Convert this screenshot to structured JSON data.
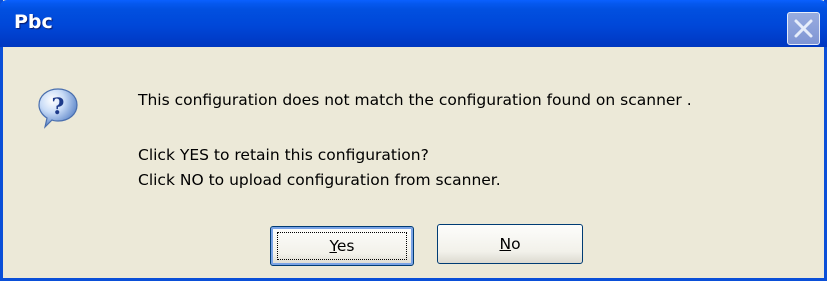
{
  "window": {
    "title": "Pbc",
    "close_label": "✕"
  },
  "icon": {
    "name": "question-icon",
    "glyph": "?"
  },
  "message": {
    "line1": "This configuration does not match the configuration found on scanner .",
    "line2": "Click YES to retain this configuration?",
    "line3": "Click NO to upload configuration from scanner."
  },
  "buttons": {
    "yes": {
      "accel": "Y",
      "rest": "es",
      "default": true
    },
    "no": {
      "accel": "N",
      "rest": "o",
      "default": false
    }
  },
  "colors": {
    "titlebar": "#0047d8",
    "dialog_bg": "#ece9d8",
    "border": "#0a4fd8"
  }
}
